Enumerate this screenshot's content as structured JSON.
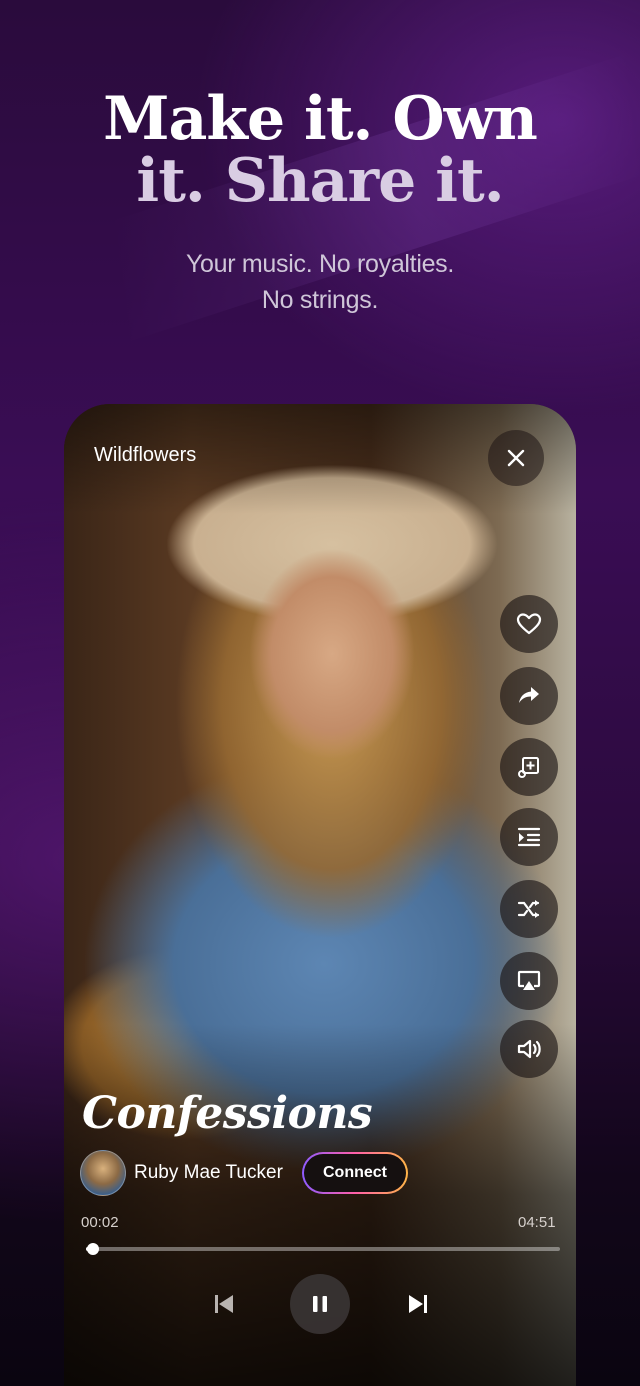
{
  "headline": {
    "line1": "Make it. Own",
    "line2": "it. Share it."
  },
  "subheadline": {
    "line1": "Your music. No royalties.",
    "line2": "No strings."
  },
  "player": {
    "album_title": "Wildflowers",
    "song_title": "Confessions",
    "artist_name": "Ruby Mae Tucker",
    "connect_label": "Connect",
    "elapsed": "00:02",
    "duration": "04:51",
    "progress": 0.007,
    "side_actions": [
      "heart-icon",
      "share-icon",
      "add-to-playlist-icon",
      "queue-icon",
      "shuffle-icon",
      "cast-icon",
      "volume-icon"
    ]
  },
  "colors": {
    "accent_gradient": [
      "#8e5bff",
      "#ff5fa8",
      "#ffb547"
    ],
    "background": "#2a0b3c"
  }
}
